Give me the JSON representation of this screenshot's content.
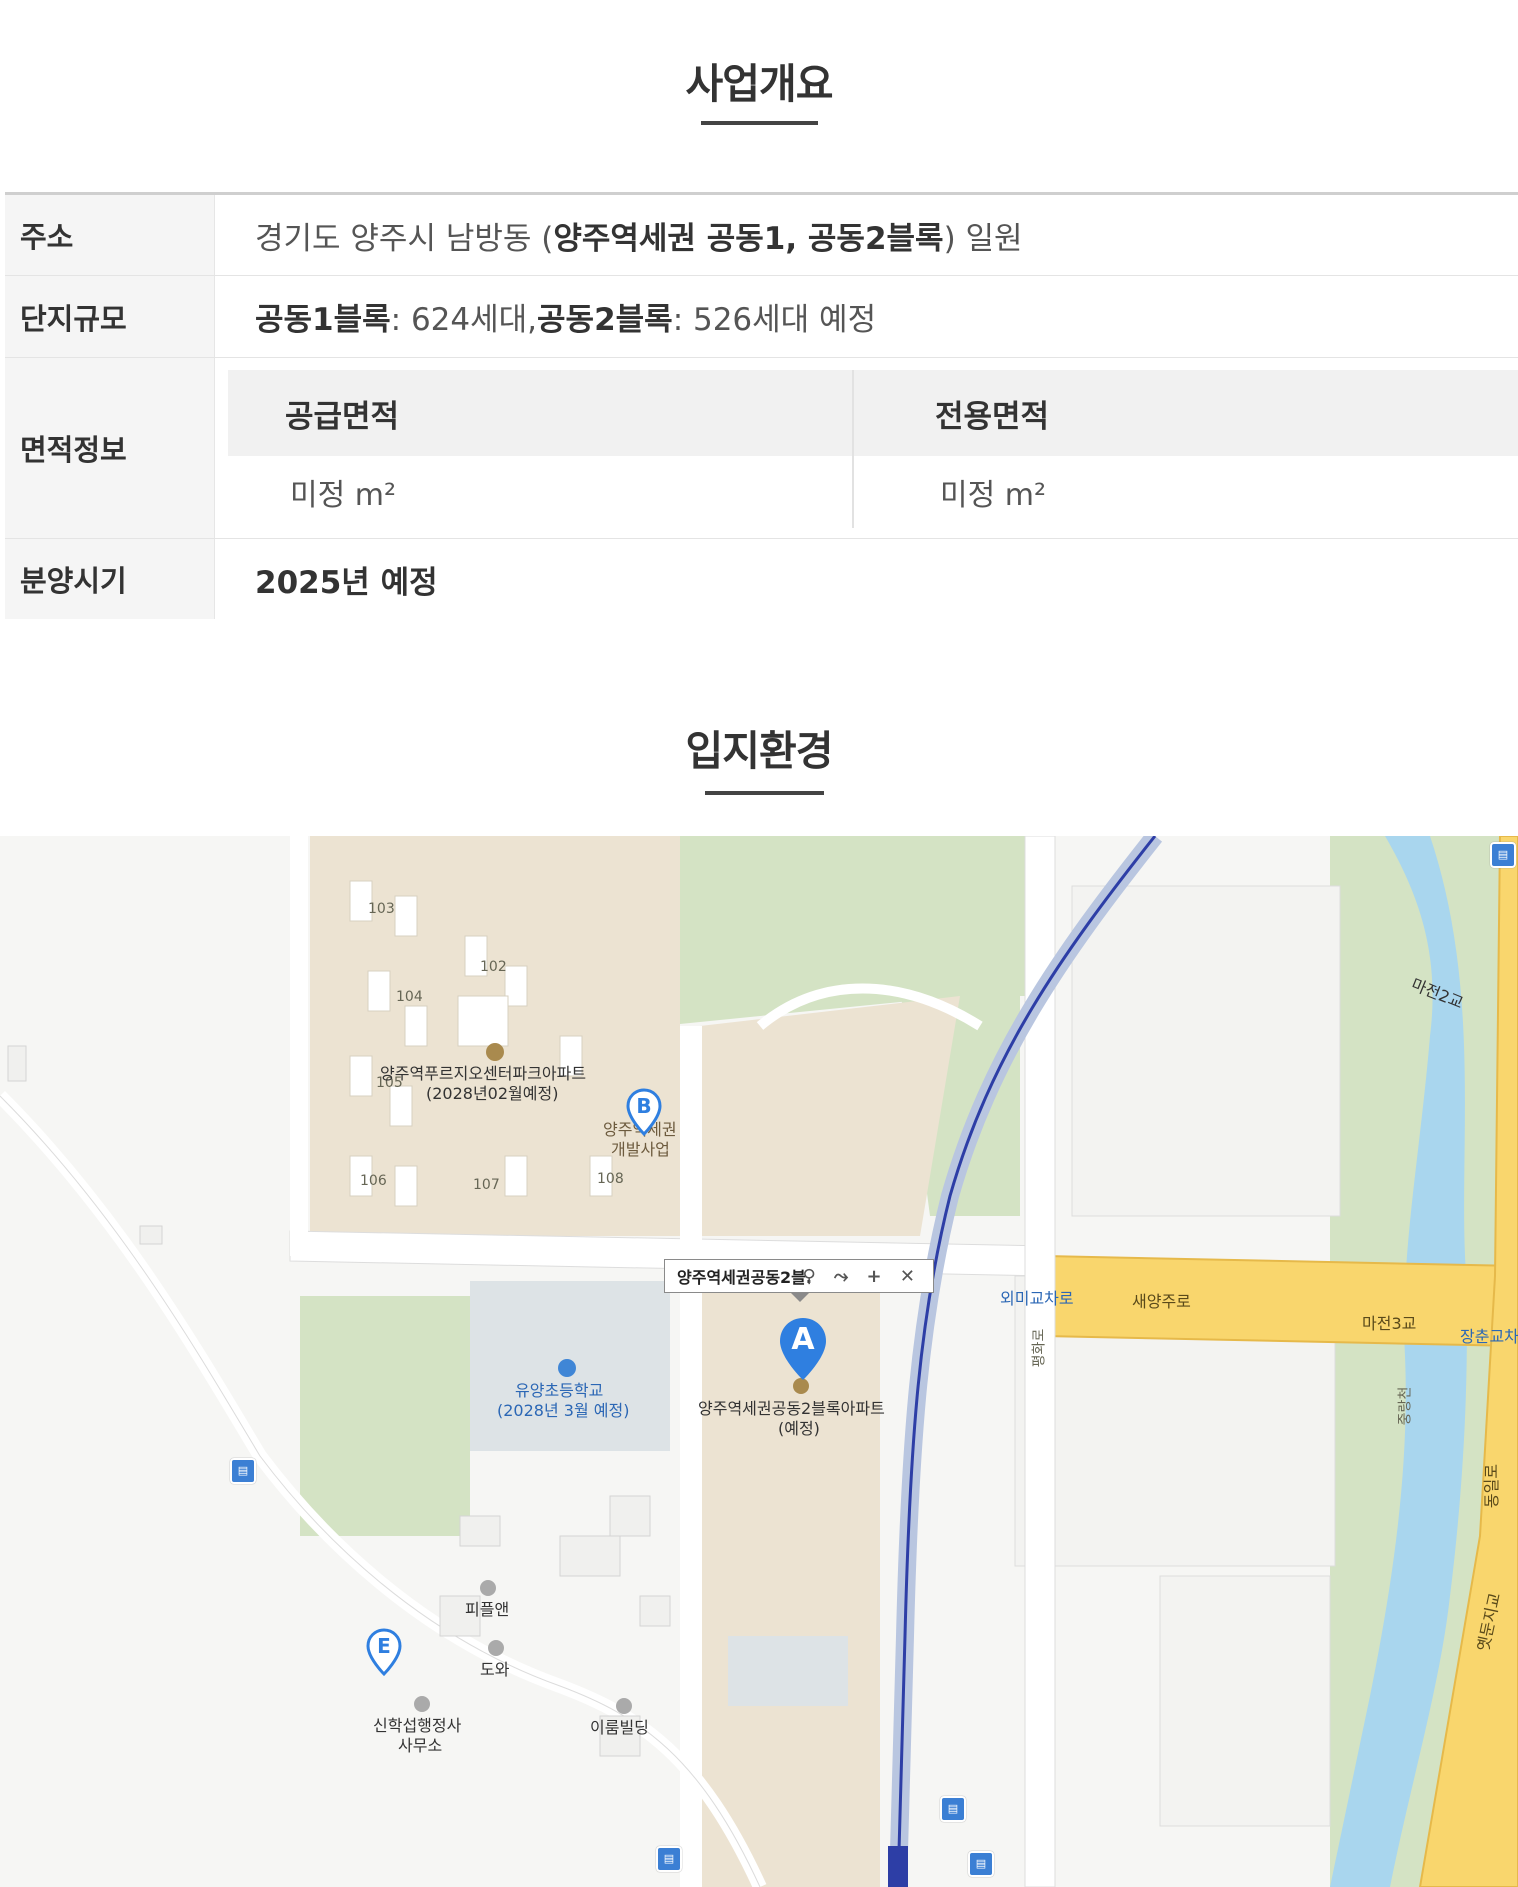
{
  "overview": {
    "title": "사업개요",
    "rows": {
      "address": {
        "label": "주소",
        "prefix": "경기도 양주시 남방동 (",
        "bold": "양주역세권 공동1, 공동2블록",
        "suffix": ") 일원"
      },
      "scale": {
        "label": "단지규모",
        "block1": "공동1블록",
        "block1_value": " : 624세대, ",
        "block2": "공동2블록",
        "block2_value": " : 526세대 예정"
      },
      "area": {
        "label": "면적정보",
        "supply_header": "공급면적",
        "exclusive_header": "전용면적",
        "supply_value": "미정 m²",
        "exclusive_value": "미정 m²"
      },
      "sale": {
        "label": "분양시기",
        "value": "2025년 예정"
      }
    }
  },
  "location": {
    "title": "입지환경",
    "map": {
      "popup_title": "양주역세권공동2블.",
      "popup_tools": "⚲ ⤳ + ✕",
      "marker_a": "A",
      "marker_b": "B",
      "marker_e": "E",
      "labels": {
        "apt_name": "양주역푸르지오센터파크아파트",
        "apt_date": "(2028년02월예정)",
        "dev_line1": "양주역세권",
        "dev_line2": "개발사업",
        "school_name": "유양초등학교",
        "school_date": "(2028년 3월 예정)",
        "site_name": "양주역세권공동2블록아파트",
        "site_note": "(예정)",
        "intersection": "외미교차로",
        "road_saeyang": "새양주로",
        "bridge_majeon3": "마전3교",
        "bridge_jangchun": "장춘교차",
        "bridge_majeon2": "마전2교",
        "road_pyeonghwa": "평화로",
        "stream_jungnang": "중랑천",
        "road_dongil": "동일로",
        "bridge_yetdunji": "옛둔지교",
        "place_peopleand": "피플앤",
        "place_dowa": "도와",
        "place_sinhak1": "신학섭행정사",
        "place_sinhak2": "사무소",
        "place_ireum": "이룸빌딩",
        "bldg_103": "103",
        "bldg_102": "102",
        "bldg_104": "104",
        "bldg_105": "105",
        "bldg_106": "106",
        "bldg_107": "107",
        "bldg_108": "108"
      }
    }
  },
  "colors": {
    "road_yellow": "#f9d66d",
    "park_green": "#d4e3c4",
    "site_beige": "#ece3d2",
    "river_blue": "#a9d6ee",
    "rail_blue": "#2d3ea6",
    "marker_blue": "#2f7fe0"
  }
}
